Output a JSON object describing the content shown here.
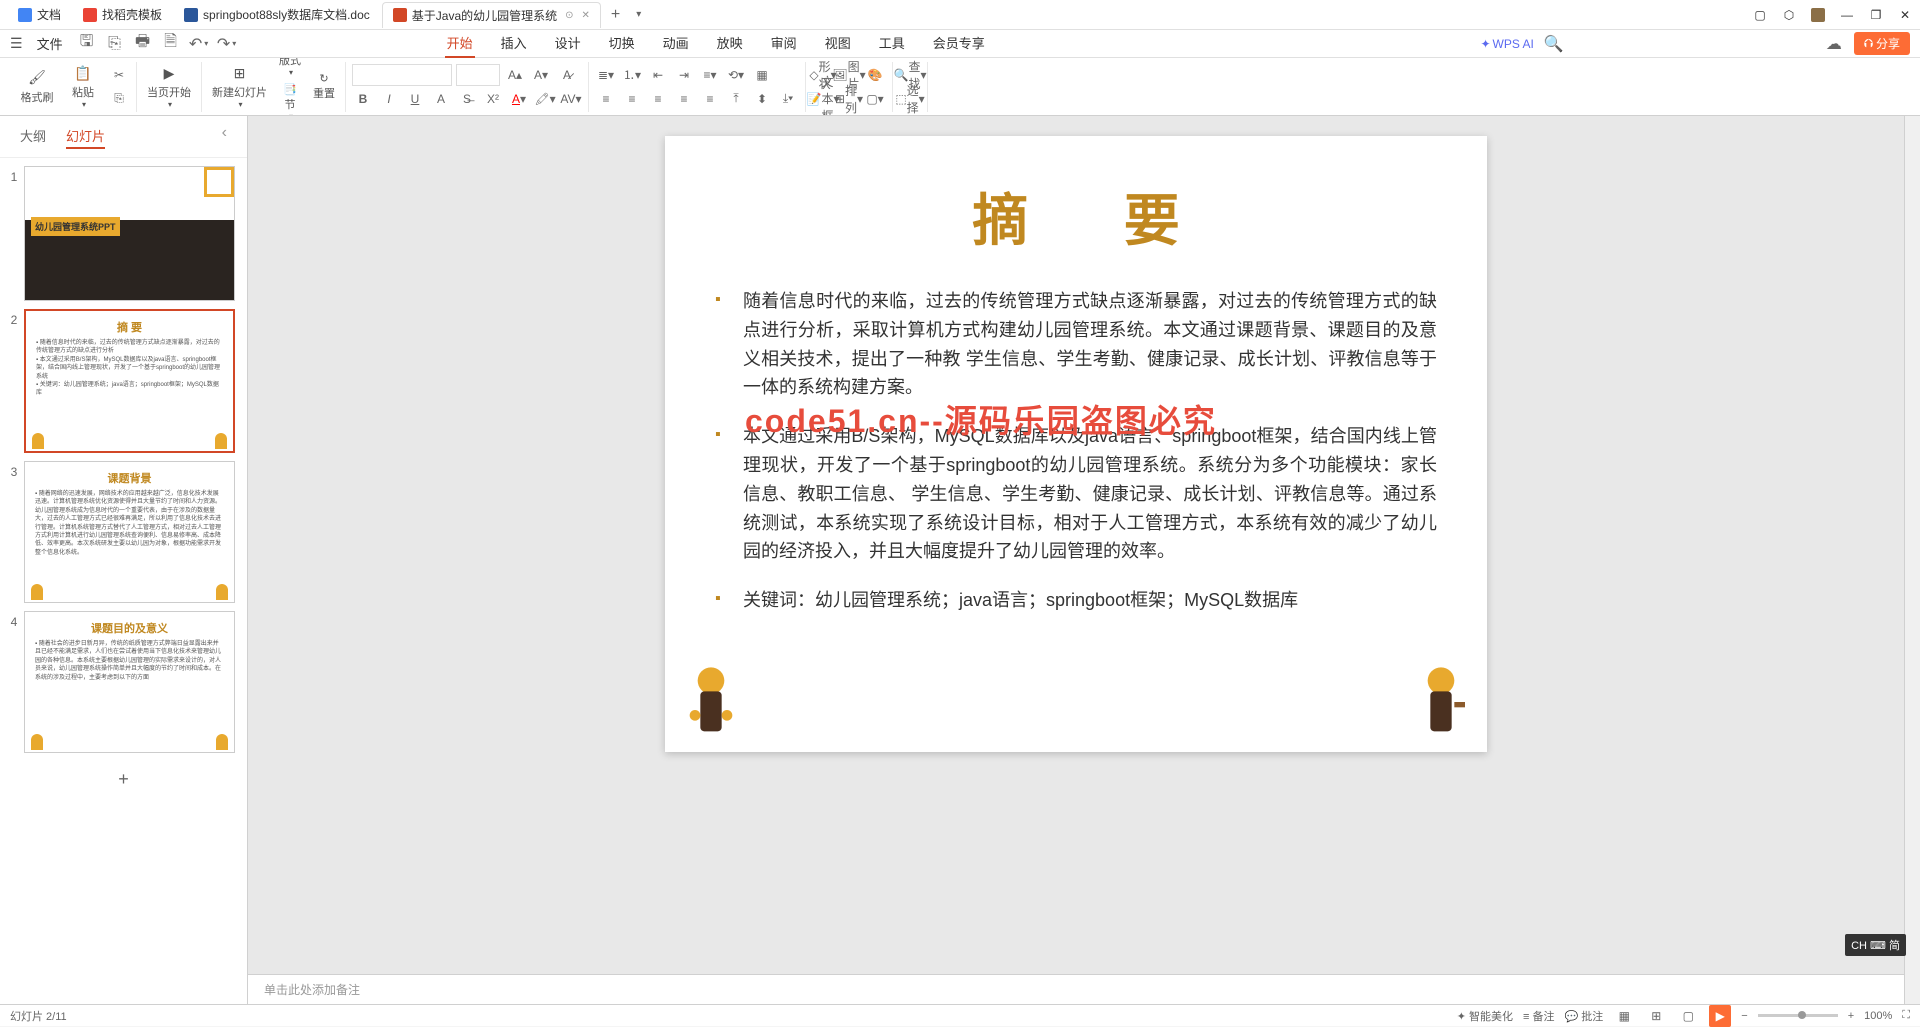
{
  "tabs": [
    {
      "label": "文档",
      "icon": "doc"
    },
    {
      "label": "找稻壳模板",
      "icon": "tmpl"
    },
    {
      "label": "springboot88sly数据库文档.doc",
      "icon": "word"
    },
    {
      "label": "基于Java的幼儿园管理系统",
      "icon": "ppt",
      "active": true
    }
  ],
  "file_menu": "文件",
  "menu_tabs": [
    "开始",
    "插入",
    "设计",
    "切换",
    "动画",
    "放映",
    "审阅",
    "视图",
    "工具",
    "会员专享"
  ],
  "menu_active": "开始",
  "wps_ai": "WPS AI",
  "share": "分享",
  "ribbon": {
    "format_painter": "格式刷",
    "paste": "粘贴",
    "start_current": "当页开始",
    "new_slide": "新建幻灯片",
    "layout": "版式",
    "section": "节",
    "reset": "重置",
    "shape": "形状",
    "textbox": "文本框",
    "picture": "图片",
    "arrange": "排列",
    "find": "查找",
    "select": "选择"
  },
  "panel": {
    "outline": "大纲",
    "slides": "幻灯片"
  },
  "thumbs": {
    "t1_title": "幼儿园管理系统PPT",
    "t2_title": "摘  要",
    "t3_title": "课题背景",
    "t4_title": "课题目的及意义"
  },
  "slide": {
    "title": "摘  要",
    "bullets": [
      "随着信息时代的来临，过去的传统管理方式缺点逐渐暴露，对过去的传统管理方式的缺点进行分析，采取计算机方式构建幼儿园管理系统。本文通过课题背景、课题目的及意义相关技术，提出了一种教 学生信息、学生考勤、健康记录、成长计划、评教信息等于一体的系统构建方案。",
      "本文通过采用B/S架构，MySQL数据库以及java语言、springboot框架，结合国内线上管理现状，开发了一个基于springboot的幼儿园管理系统。系统分为多个功能模块：家长信息、教职工信息、 学生信息、学生考勤、健康记录、成长计划、评教信息等。通过系统测试，本系统实现了系统设计目标，相对于人工管理方式，本系统有效的减少了幼儿园的经济投入，并且大幅度提升了幼儿园管理的效率。",
      "关键词：幼儿园管理系统；java语言；springboot框架；MySQL数据库"
    ],
    "watermark": "code51.cn--源码乐园盗图必究"
  },
  "notes_placeholder": "单击此处添加备注",
  "ime": "CH ⌨ 简",
  "status": {
    "slide_count": "幻灯片 2/11",
    "smart_beautify": "智能美化",
    "notes_btn": "备注",
    "comments_btn": "批注",
    "zoom": "100%"
  }
}
